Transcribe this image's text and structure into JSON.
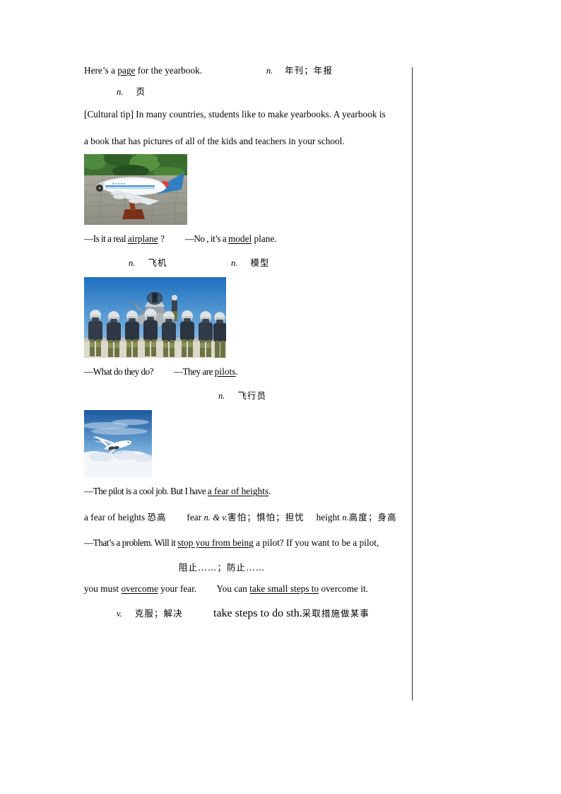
{
  "document": {
    "type": "english-textbook-lesson-page",
    "language_mix": "English with Chinese glosses"
  },
  "lines": {
    "l1_sentence": "Here’s a page for the yearbook.",
    "l1_before": "Here’s a ",
    "l1_keyword": "page",
    "l1_after": " for the yearbook.",
    "l1_gloss_pos": "n.",
    "l1_gloss_cn": "年刊；年报",
    "l2_gloss_pos": "n.",
    "l2_gloss_cn": "页",
    "cultural_tip_1": "[Cultural tip] In many countries, students like to make yearbooks. A yearbook is",
    "cultural_tip_2": "a book that has pictures of all of the kids and teachers in your school.",
    "q1_a": "—Is it a real ",
    "q1_key": "airplane",
    "q1_b": " ?",
    "q1_c": "—No , it’s a ",
    "q1_key2": "model",
    "q1_d": " plane.",
    "q1_gloss1_pos": "n.",
    "q1_gloss1_cn": "飞机",
    "q1_gloss2_pos": "n.",
    "q1_gloss2_cn": "模型",
    "q2_a": "—What do they do?",
    "q2_b": "—They are ",
    "q2_key": "pilots",
    "q2_c": ".",
    "q2_gloss_pos": "n.",
    "q2_gloss_cn": "飞行员",
    "q3_a": "—The pilot is a cool job. But I have ",
    "q3_key": "a fear of heights",
    "q3_b": ".",
    "vocab_line_a": "a fear of heights ",
    "vocab_line_a_cn": "恐高",
    "vocab_line_b": "fear ",
    "vocab_line_b_pos": "n. & v.",
    "vocab_line_b_cn": "害怕；惧怕；担忧",
    "vocab_line_c": "height ",
    "vocab_line_c_pos": "n.",
    "vocab_line_c_cn": "高度；身高",
    "q4_a": "—That’s a problem. Will it ",
    "q4_key": "stop you from being",
    "q4_b": " a pilot? If you want to be a pilot,",
    "q4_gloss_cn": "阻止……；防止……",
    "q5_a": "you must ",
    "q5_key": "overcome",
    "q5_b": " your fear.",
    "q5_c": "You can ",
    "q5_key2": "take small steps to",
    "q5_d": " overcome it.",
    "q5_gloss_pos": "v.",
    "q5_gloss_cn": "克服；解决",
    "q5_gloss2_en": "take steps to do sth.",
    "q5_gloss2_cn": "采取措施做某事"
  },
  "figures": {
    "model_airplane": {
      "alt": "White and blue model airliner on a wooden display stand, pavement and green foliage background",
      "sky": "#7fa7c8",
      "body": "#f2f4f6",
      "tail": "#2f7fc1",
      "ground": "#9b9a90",
      "foliage": "#3f7a35",
      "stand": "#7a2f18"
    },
    "pilots_group": {
      "alt": "Row of pilots in flight suits and helmets standing in front of a fighter jet under blue sky",
      "sky": "#2f7fc4",
      "suit": "#2b3440",
      "helmet": "#d8dde2",
      "jet": "#b9bfc4",
      "ground": "#d9d5c9"
    },
    "jet_in_sky": {
      "alt": "Business jet flying above a layer of white clouds in a blue sky",
      "sky": "#1f5fa8",
      "cloud": "#f1f5f8",
      "plane": "#ffffff"
    }
  }
}
